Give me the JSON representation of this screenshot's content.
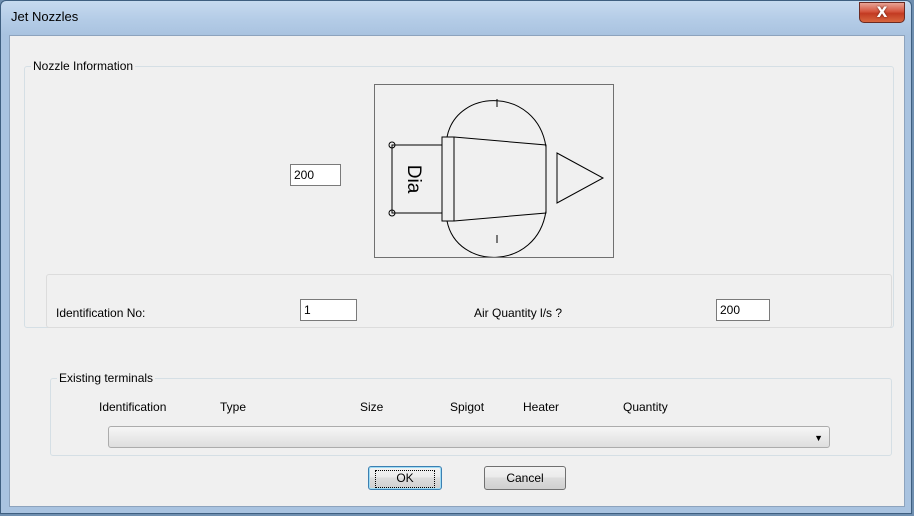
{
  "window": {
    "title": "Jet Nozzles",
    "close_glyph": "X",
    "close_icon": "close-icon"
  },
  "nozzle_info": {
    "group_label": "Nozzle Information",
    "diameter_value": "200",
    "diagram_label": "Dia",
    "identification_label": "Identification No:",
    "identification_value": "1",
    "air_quantity_label": "Air Quantity l/s ?",
    "air_quantity_value": "200"
  },
  "existing_terminals": {
    "group_label": "Existing terminals",
    "columns": [
      "Identification",
      "Type",
      "Size",
      "Spigot",
      "Heater",
      "Quantity"
    ],
    "selected_value": ""
  },
  "buttons": {
    "ok_label": "OK",
    "cancel_label": "Cancel"
  },
  "colors": {
    "titlebar": "#b3cbe6",
    "close": "#c9452c",
    "dialog": "#f0f0f0"
  }
}
